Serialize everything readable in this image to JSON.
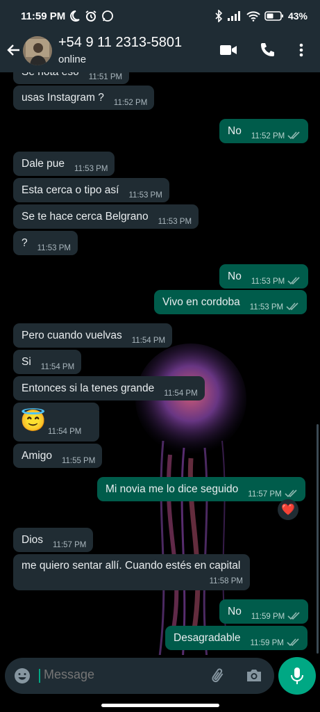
{
  "status_bar": {
    "time": "11:59 PM",
    "battery": "43%"
  },
  "header": {
    "name": "+54 9 11 2313-5801",
    "status": "online"
  },
  "messages": [
    {
      "dir": "in",
      "text": "Se nota eso",
      "time": "11:51 PM"
    },
    {
      "dir": "in",
      "text": "usas Instagram ?",
      "time": "11:52 PM"
    },
    {
      "dir": "out",
      "text": "No",
      "time": "11:52 PM"
    },
    {
      "dir": "in",
      "text": "Dale pue",
      "time": "11:53 PM"
    },
    {
      "dir": "in",
      "text": "Esta cerca o tipo así",
      "time": "11:53 PM"
    },
    {
      "dir": "in",
      "text": "Se te hace cerca Belgrano",
      "time": "11:53 PM"
    },
    {
      "dir": "in",
      "text": "?",
      "time": "11:53 PM"
    },
    {
      "dir": "out",
      "text": "No",
      "time": "11:53 PM"
    },
    {
      "dir": "out",
      "text": "Vivo en cordoba",
      "time": "11:53 PM"
    },
    {
      "dir": "in",
      "text": "Pero cuando vuelvas",
      "time": "11:54 PM"
    },
    {
      "dir": "in",
      "text": "Si",
      "time": "11:54 PM"
    },
    {
      "dir": "in",
      "text": "Entonces si la tenes grande",
      "time": "11:54 PM"
    },
    {
      "dir": "in",
      "text": "😇",
      "time": "11:54 PM"
    },
    {
      "dir": "in",
      "text": "Amigo",
      "time": "11:55 PM"
    },
    {
      "dir": "out",
      "text": "Mi novia me lo dice seguido",
      "time": "11:57 PM",
      "reaction": "❤️"
    },
    {
      "dir": "in",
      "text": "Dios",
      "time": "11:57 PM"
    },
    {
      "dir": "in",
      "text": "me quiero sentar allí. Cuando estés en capital",
      "time": "11:58 PM"
    },
    {
      "dir": "out",
      "text": "No",
      "time": "11:59 PM"
    },
    {
      "dir": "out",
      "text": "Desagradable",
      "time": "11:59 PM"
    }
  ],
  "composer": {
    "placeholder": "Message"
  },
  "colors": {
    "header_bg": "#1f2c34",
    "incoming": "#202c33",
    "outgoing": "#005c4b",
    "accent": "#00a884",
    "read_tick": "#8fb9b1"
  },
  "icons": [
    "back-arrow-icon",
    "video-call-icon",
    "phone-icon",
    "more-options-icon",
    "emoji-icon",
    "attach-icon",
    "camera-icon",
    "mic-icon",
    "read-receipt-icon",
    "heart-reaction-icon"
  ]
}
